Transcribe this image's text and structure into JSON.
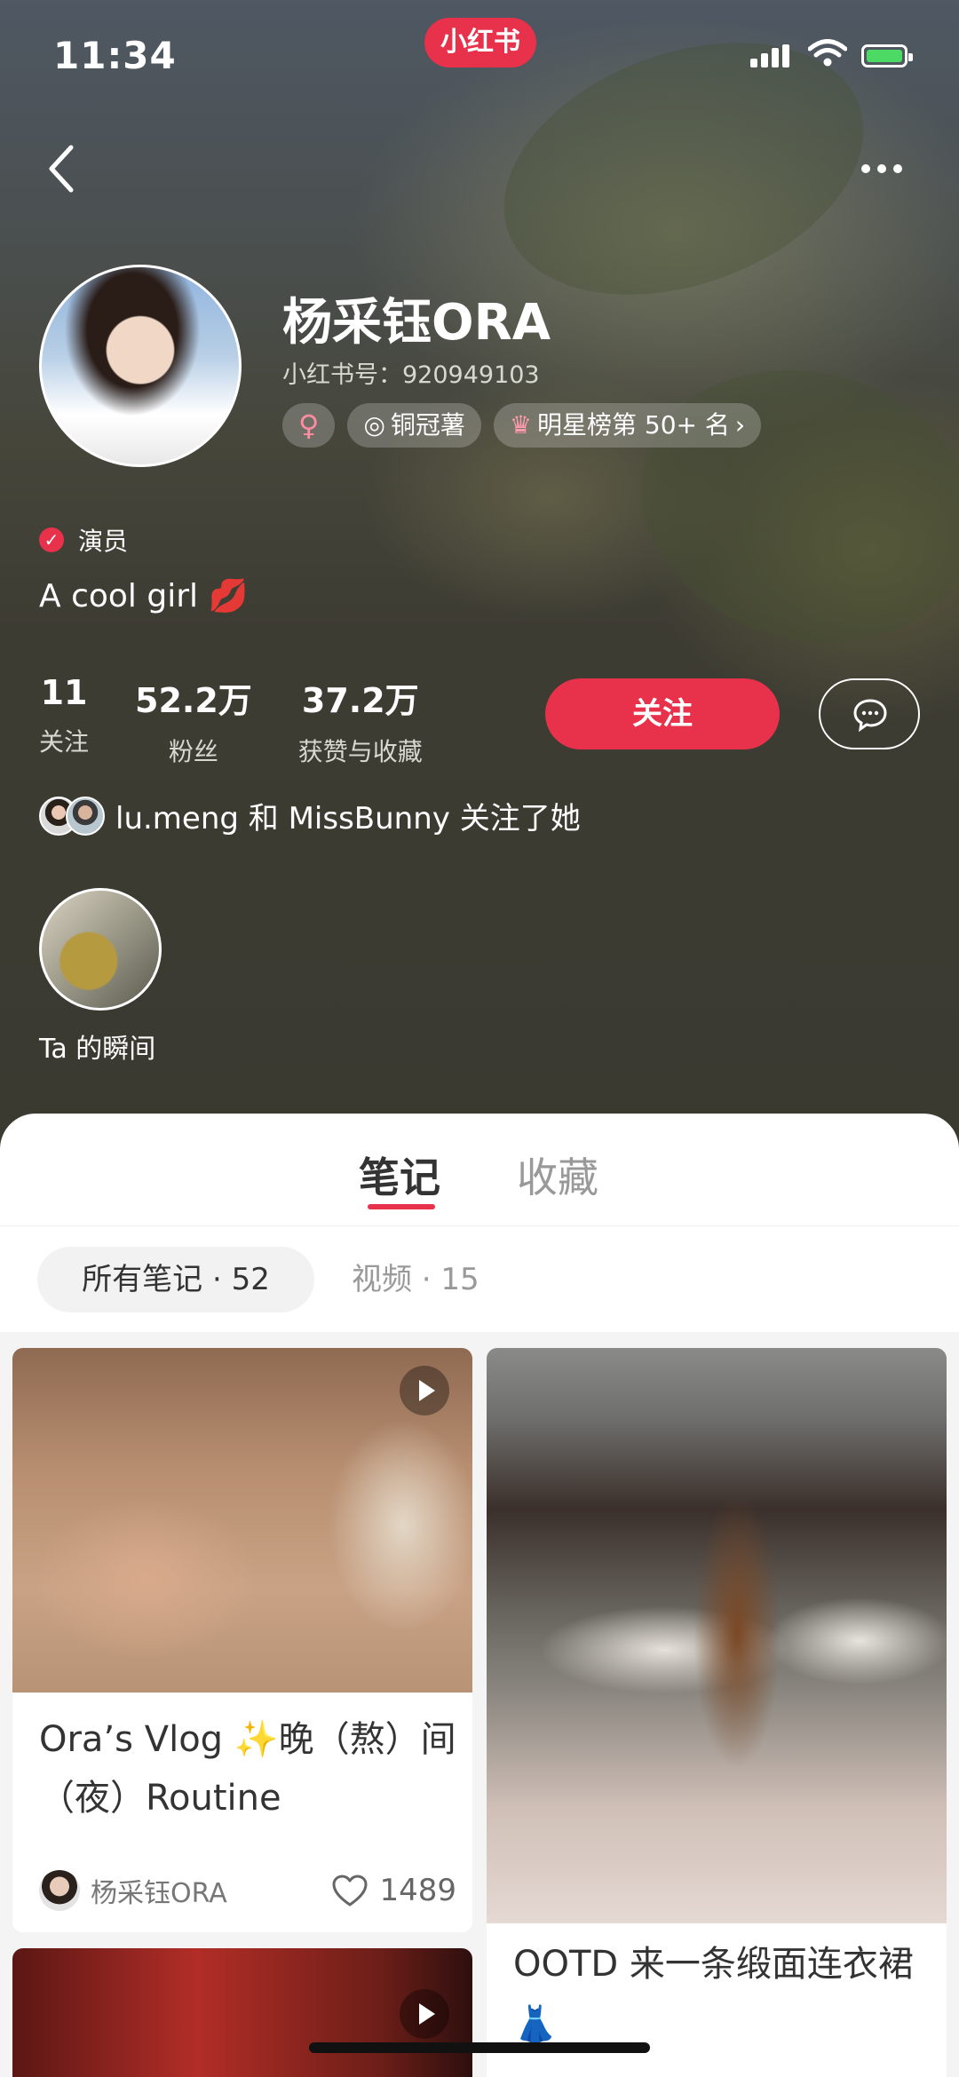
{
  "status_bar": {
    "time": "11:34",
    "app_logo": "小红书"
  },
  "profile": {
    "name": "杨采钰ORA",
    "red_id": "小红书号：920949103",
    "tags": [
      {
        "icon": "female-icon",
        "label": "♀"
      },
      {
        "icon": "medal-icon",
        "label": "铜冠薯"
      },
      {
        "icon": "crown-icon",
        "label": "明星榜第 50+ 名"
      }
    ],
    "verification": "演员",
    "bio": "A cool girl 💋",
    "stats": [
      {
        "value": "11",
        "label": "关注"
      },
      {
        "value": "52.2万",
        "label": "粉丝"
      },
      {
        "value": "37.2万",
        "label": "获赞与收藏"
      }
    ],
    "follow_button": "关注",
    "mutual_follow": "lu.meng 和 MissBunny 关注了她",
    "moment_label": "Ta 的瞬间"
  },
  "tabs": [
    {
      "label": "笔记",
      "active": true
    },
    {
      "label": "收藏",
      "active": false
    }
  ],
  "filters": [
    {
      "label": "所有笔记 · 52",
      "active": true
    },
    {
      "label": "视频 · 15",
      "active": false
    }
  ],
  "notes": [
    {
      "title": "Ora’s Vlog ✨晚（熬）间（夜）Routine",
      "author": "杨采钰ORA",
      "likes": "1489",
      "is_video": true
    },
    {
      "title": "OOTD 来一条缎面连衣裙👗",
      "is_video": false
    },
    {
      "title": "",
      "is_video": true
    }
  ],
  "colors": {
    "accent": "#e8314a"
  }
}
